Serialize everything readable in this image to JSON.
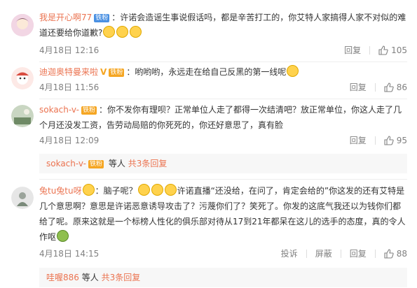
{
  "comments": [
    {
      "user": "我是开心啊77",
      "badge": "铁粉",
      "text": "：许诺会造谣生事说假话吗，都是辛苦打工的，你艾特人家搞得人家不对似的难道还要给你道歉?",
      "date": "4月18日 12:16",
      "reply_label": "回复",
      "likes": "105"
    },
    {
      "user": "迪迦奥特曼来啦",
      "badge": "铁粉",
      "text": "：哟哟哟，永远走在给自己反黑的第一线呢",
      "date": "4月18日 11:56",
      "reply_label": "回复",
      "likes": "86"
    },
    {
      "user": "sokach-v-",
      "badge": "铁粉",
      "text": "：你不发你有理呗？正常单位人走了都得一次结清吧？放正常单位，你这人走了几个月还没发工资，告劳动局赔的你死死的，你还好意思了，真有脸",
      "date": "4月18日 12:09",
      "reply_label": "回复",
      "likes": "95"
    },
    {
      "user": "兔tu兔tu呀",
      "text_a": "：脑子呢？",
      "text_b": "许诺直播“还没给，在问了，肯定会给的”你这发的还有艾特是几个意思啊？意思是许诺恶意诱导攻击了？污蔑你们了？笑死了。你发的这底气我还以为钱你们都给了呢。原来这就是一个标榜人性化的俱乐部对待从17到21年都呆在这儿的选手的态度，真的令人作呕",
      "date": "4月18日 14:15",
      "report_label": "投诉",
      "block_label": "屏蔽",
      "reply_label": "回复",
      "likes": "88"
    }
  ],
  "subreplies": [
    {
      "user": "sokach-v-",
      "suffix": "等人",
      "more": "共3条回复"
    },
    {
      "user": "哇喔886",
      "suffix": "等人",
      "more": "共3条回复"
    }
  ]
}
